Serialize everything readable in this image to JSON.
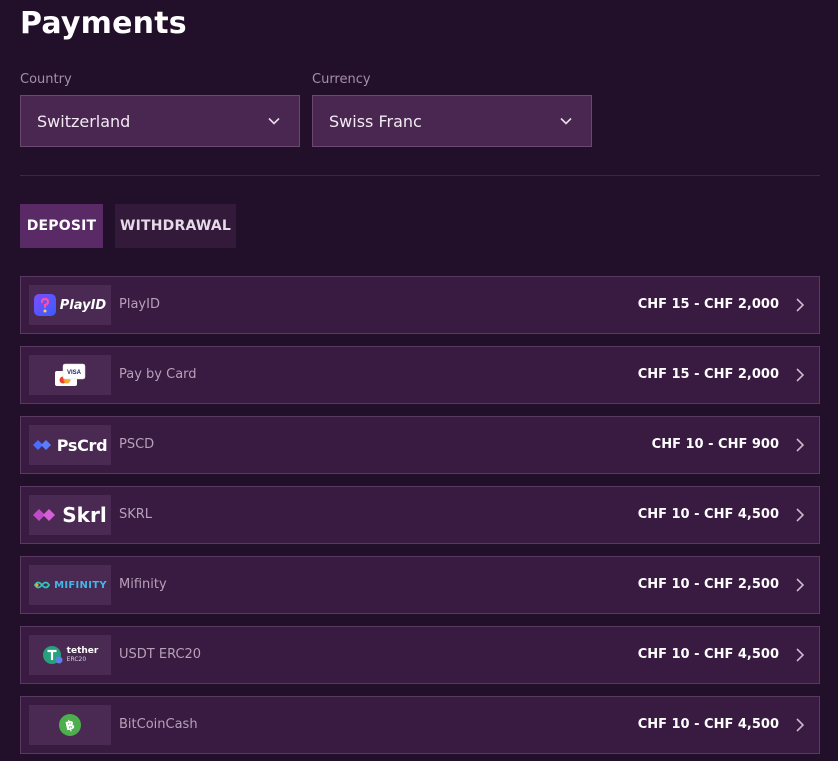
{
  "page": {
    "title": "Payments"
  },
  "filters": {
    "country_label": "Country",
    "country_value": "Switzerland",
    "currency_label": "Currency",
    "currency_value": "Swiss Franc"
  },
  "tabs": [
    {
      "label": "DEPOSIT",
      "active": true
    },
    {
      "label": "WITHDRAWAL",
      "active": false
    }
  ],
  "methods": [
    {
      "logo_text": "PlayID",
      "logo_icon": "playid-icon",
      "name": "PlayID",
      "range": "CHF 15 - CHF 2,000"
    },
    {
      "logo_text": "VISA",
      "logo_icon": "card-icon",
      "name": "Pay by Card",
      "range": "CHF 15 - CHF 2,000"
    },
    {
      "logo_text": "PsCrd",
      "logo_icon": "pscrd-icon",
      "name": "PSCD",
      "range": "CHF 10 - CHF 900"
    },
    {
      "logo_text": "Skrl",
      "logo_icon": "skrl-icon",
      "name": "SKRL",
      "range": "CHF 10 - CHF 4,500"
    },
    {
      "logo_text": "MIFINITY",
      "logo_icon": "mifinity-icon",
      "name": "Mifinity",
      "range": "CHF 10 - CHF 2,500"
    },
    {
      "logo_text": "tether",
      "logo_subtext": "ERC20",
      "logo_icon": "tether-icon",
      "name": "USDT ERC20",
      "range": "CHF 10 - CHF 4,500"
    },
    {
      "logo_text": "",
      "logo_icon": "bitcoin-cash-icon",
      "name": "BitCoinCash",
      "range": "CHF 10 - CHF 4,500"
    }
  ],
  "colors": {
    "background": "#22102a",
    "row_background": "#391a40",
    "active_tab": "#5a2a66",
    "select_background": "#4a2750"
  }
}
